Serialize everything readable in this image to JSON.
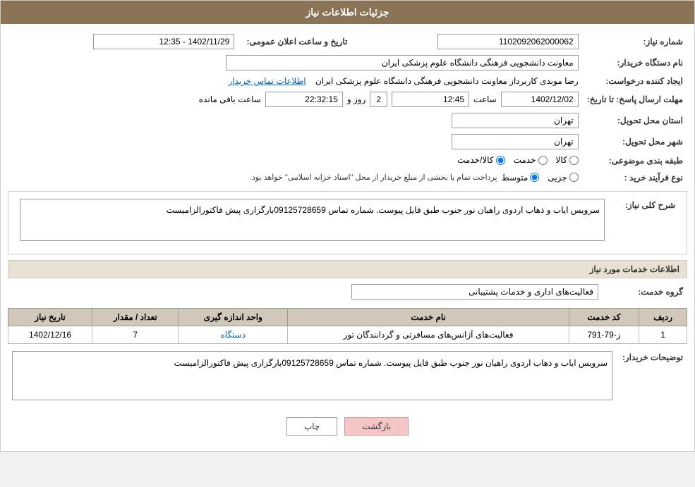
{
  "header": {
    "title": "جزئیات اطلاعات نیاز"
  },
  "fields": {
    "need_number_label": "شماره نیاز:",
    "need_number_value": "1102092062000062",
    "requester_org_label": "نام دستگاه خریدار:",
    "requester_org_value": "معاونت دانشجویی  فرهنگی دانشگاه علوم پزشکی ایران",
    "creator_label": "ایجاد کننده درخواست:",
    "creator_value": "رضا  موبدی  کاربرداز معاونت دانشجویی  فرهنگی دانشگاه علوم پزشکی ایران",
    "contact_link": "اطلاعات تماس خریدار",
    "send_deadline_label": "مهلت ارسال پاسخ: تا تاریخ:",
    "send_date_value": "1402/12/02",
    "send_time_value": "12:45",
    "send_days_value": "2",
    "send_remaining_value": "22:32:15",
    "send_days_label": "روز و",
    "send_remaining_label": "ساعت باقی مانده",
    "province_label": "استان محل تحویل:",
    "province_value": "تهران",
    "city_label": "شهر محل تحویل:",
    "city_value": "تهران",
    "category_label": "طبقه بندی موضوعی:",
    "category_options": [
      "کالا",
      "خدمت",
      "کالا/خدمت"
    ],
    "category_selected": "کالا",
    "purchase_type_label": "نوع فرآیند خرید :",
    "purchase_type_options": [
      "جزیی",
      "متوسط"
    ],
    "purchase_type_selected": "متوسط",
    "purchase_type_note": "پرداخت تمام یا بخشی از مبلغ خریدار از محل \"اسناد خزانه اسلامی\" خواهد بود.",
    "announcement_date_label": "تاریخ و ساعت اعلان عمومی:",
    "announcement_date_value": "1402/11/29 - 12:35"
  },
  "description": {
    "section_label": "شرح کلی نیاز:",
    "text": "سرویس ایاب و ذهاب اردوی راهیان نور جنوب طبق فایل پیوست. شماره تماس 09125728659بارگزاری پیش فاکتورالزامیست"
  },
  "services": {
    "section_label": "اطلاعات خدمات مورد نیاز",
    "group_label": "گروه خدمت:",
    "group_value": "فعالیت‌های اداری و خدمات پشتیبانی",
    "table_headers": [
      "ردیف",
      "کد خدمت",
      "نام خدمت",
      "واحد اندازه گیری",
      "تعداد / مقدار",
      "تاریخ نیاز"
    ],
    "table_rows": [
      {
        "row": "1",
        "code": "ز-79-791",
        "name": "فعالیت‌های آژانس‌های مسافرتی و گردانندگان تور",
        "unit": "دستگاه",
        "quantity": "7",
        "date": "1402/12/16"
      }
    ]
  },
  "buyer_description": {
    "section_label": "توضیحات خریدار:",
    "text": "سرویس ایاب و ذهاب اردوی راهیان نور جنوب طبق فایل پیوست. شماره تماس 09125728659بارگزاری پیش فاکتورالزامیست"
  },
  "buttons": {
    "print_label": "چاپ",
    "back_label": "بازگشت"
  }
}
